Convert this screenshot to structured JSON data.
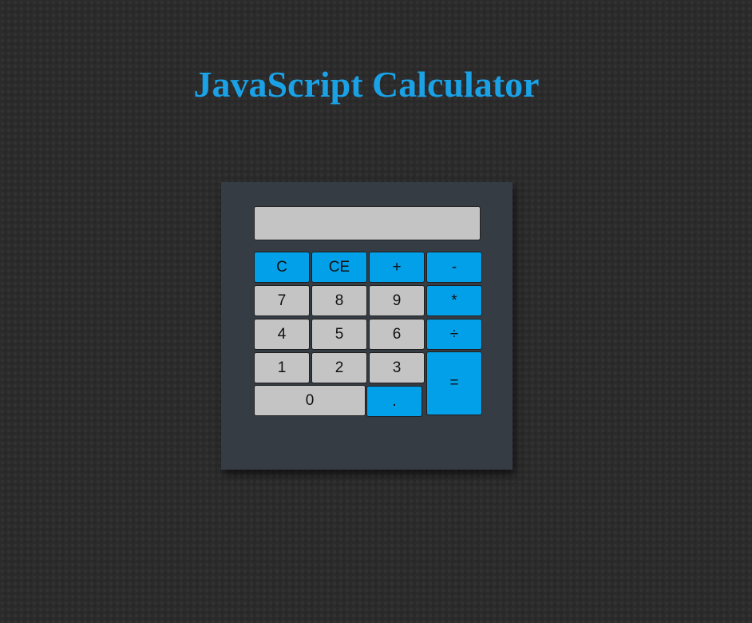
{
  "page": {
    "title": "JavaScript Calculator"
  },
  "display": {
    "value": ""
  },
  "keys": {
    "clear": "C",
    "clear_entry": "CE",
    "plus": "+",
    "minus": "-",
    "seven": "7",
    "eight": "8",
    "nine": "9",
    "multiply": "*",
    "four": "4",
    "five": "5",
    "six": "6",
    "divide": "÷",
    "one": "1",
    "two": "2",
    "three": "3",
    "equals": "=",
    "zero": "0",
    "decimal": "."
  },
  "colors": {
    "title": "#1aa1e6",
    "operator_key": "#02a0e8",
    "number_key": "#c4c4c4",
    "calculator_body": "#363c44",
    "background": "#2b2b2b"
  }
}
